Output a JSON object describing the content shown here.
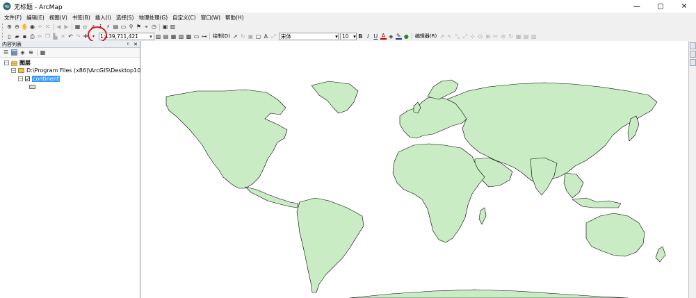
{
  "window": {
    "title": "无标题 - ArcMap",
    "min_glyph": "—",
    "max_glyph": "▢",
    "close_glyph": "✕"
  },
  "menu": [
    "文件(F)",
    "编辑(E)",
    "视图(V)",
    "书签(B)",
    "插入(I)",
    "选择(S)",
    "地理处理(G)",
    "自定义(C)",
    "窗口(W)",
    "帮助(H)"
  ],
  "toolbar": {
    "scale": "1:139,711,421",
    "drawing_label": "绘制(D)",
    "editor_label": "编辑器(R)",
    "font_name": "宋体",
    "font_size": "10",
    "bold": "B",
    "italic": "I",
    "underline": "U",
    "font_color_label": "A",
    "text_label": "A"
  },
  "toc": {
    "title": "内容列表",
    "pin_glyph": "ᵖ",
    "close_glyph": "✕",
    "layers_label": "图层",
    "folder_path": "D:\\Program Files (x86)\\ArcGIS\\Desktop10.2",
    "layer_name": "continent",
    "layer_color": "#c9ecc4"
  },
  "map": {
    "land_color": "#c9ecc4",
    "outline_color": "#000000"
  },
  "colors": {
    "selection": "#3399ff",
    "annotation_circle": "#d81c1c"
  }
}
